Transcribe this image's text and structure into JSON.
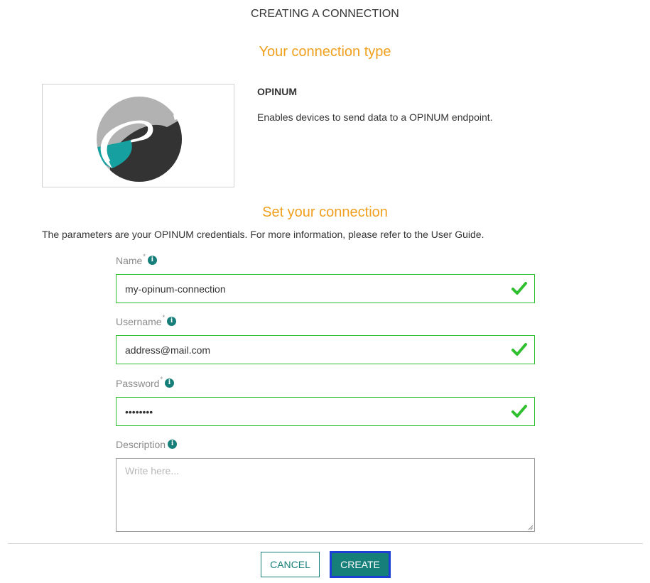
{
  "page": {
    "title": "CREATING A CONNECTION"
  },
  "connection_type": {
    "heading": "Your connection type",
    "name": "OPINUM",
    "description": "Enables devices to send data to a OPINUM endpoint."
  },
  "set_connection": {
    "heading": "Set your connection",
    "intro": "The parameters are your OPINUM credentials. For more information, please refer to the User Guide."
  },
  "fields": {
    "name": {
      "label": "Name",
      "required_mark": "*",
      "value": "my-opinum-connection"
    },
    "username": {
      "label": "Username",
      "required_mark": "*",
      "value": "address@mail.com"
    },
    "password": {
      "label": "Password",
      "required_mark": "*",
      "value": "opinum12"
    },
    "description": {
      "label": "Description",
      "placeholder": "Write here...",
      "value": ""
    }
  },
  "icons": {
    "info": "info-icon",
    "valid": "check-icon",
    "info_glyph": "i"
  },
  "buttons": {
    "cancel": "CANCEL",
    "create": "CREATE"
  },
  "colors": {
    "accent": "#177f7a",
    "heading": "#f0a01e",
    "valid": "#2fbf2f",
    "focus": "#1e3fd6"
  }
}
